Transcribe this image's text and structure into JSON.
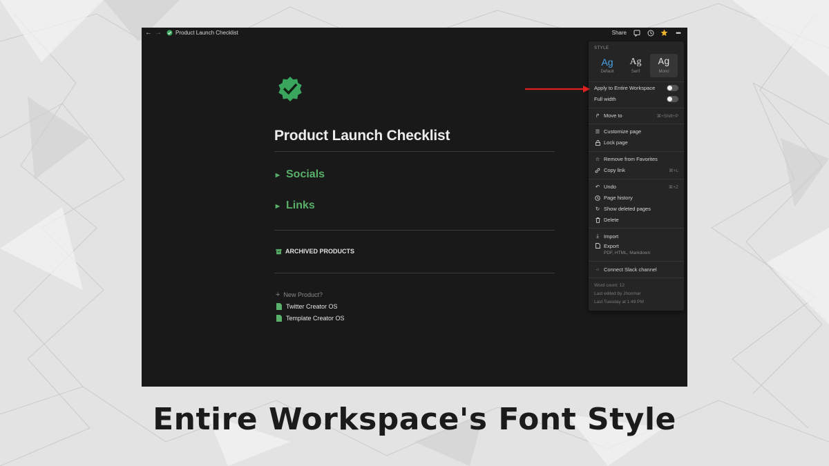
{
  "caption": "Entire Workspace's Font Style",
  "topbar": {
    "title": "Product Launch Checklist",
    "share_label": "Share"
  },
  "page": {
    "title": "Product Launch Checklist",
    "toggles": [
      {
        "label": "Socials",
        "icon": "triangle-right-icon"
      },
      {
        "label": "Links",
        "icon": "triangle-right-icon"
      }
    ],
    "archived_label": "ARCHIVED PRODUCTS",
    "new_product_label": "New Product?",
    "documents": [
      {
        "label": "Twitter Creator OS",
        "icon": "document-icon"
      },
      {
        "label": "Template Creator OS",
        "icon": "document-icon"
      }
    ]
  },
  "menu": {
    "style_section_label": "STYLE",
    "style_options": [
      {
        "sample": "Ag",
        "name": "Default",
        "selected": false,
        "color": "#4aa3e8"
      },
      {
        "sample": "Ag",
        "name": "Serif",
        "selected": false,
        "color": "#e0e0e0"
      },
      {
        "sample": "Ag",
        "name": "Mono",
        "selected": true,
        "color": "#e0e0e0"
      }
    ],
    "apply_workspace_label": "Apply to Entire Workspace",
    "apply_workspace_on": false,
    "full_width_label": "Full width",
    "full_width_on": false,
    "move_to": {
      "label": "Move to",
      "shortcut": "⌘+Shift+P"
    },
    "customize_page": "Customize page",
    "lock_page": "Lock page",
    "remove_favorites": "Remove from Favorites",
    "copy_link": {
      "label": "Copy link",
      "shortcut": "⌘+L"
    },
    "undo": {
      "label": "Undo",
      "shortcut": "⌘+Z"
    },
    "page_history": "Page history",
    "show_deleted": "Show deleted pages",
    "delete": "Delete",
    "import": "Import",
    "export": {
      "label": "Export",
      "sub": "PDF, HTML, Markdown"
    },
    "connect_slack": "Connect Slack channel",
    "footer": {
      "word_count": "Word count: 12",
      "last_edited_by": "Last edited by Jhonmar",
      "last_edited_at": "Last Tuesday at 1:49 PM"
    }
  },
  "colors": {
    "accent_green": "#58b06a",
    "badge_green": "#3aa55c",
    "arrow_red": "#e02020",
    "star": "#f0b429"
  }
}
